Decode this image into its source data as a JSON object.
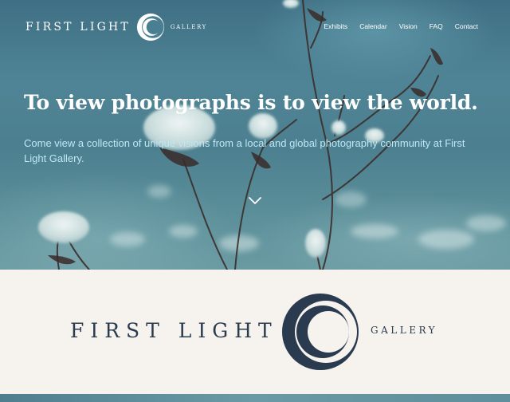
{
  "header": {
    "logo_left": "FIRST LIGHT",
    "logo_right": "GALLERY"
  },
  "nav": {
    "items": [
      {
        "label": "Exhibits"
      },
      {
        "label": "Calendar"
      },
      {
        "label": "Vision"
      },
      {
        "label": "FAQ"
      },
      {
        "label": "Contact"
      }
    ]
  },
  "hero": {
    "headline": "To view photographs is to view the world.",
    "subtext": "Come view a collection of unique visions from a local and global photography community at First Light Gallery."
  },
  "brand": {
    "name_left": "FIRST LIGHT",
    "name_right": "GALLERY",
    "color": "#2a3b4f"
  },
  "icons": {
    "logo": "double-crescent-icon",
    "scroll": "chevron-down-icon"
  }
}
